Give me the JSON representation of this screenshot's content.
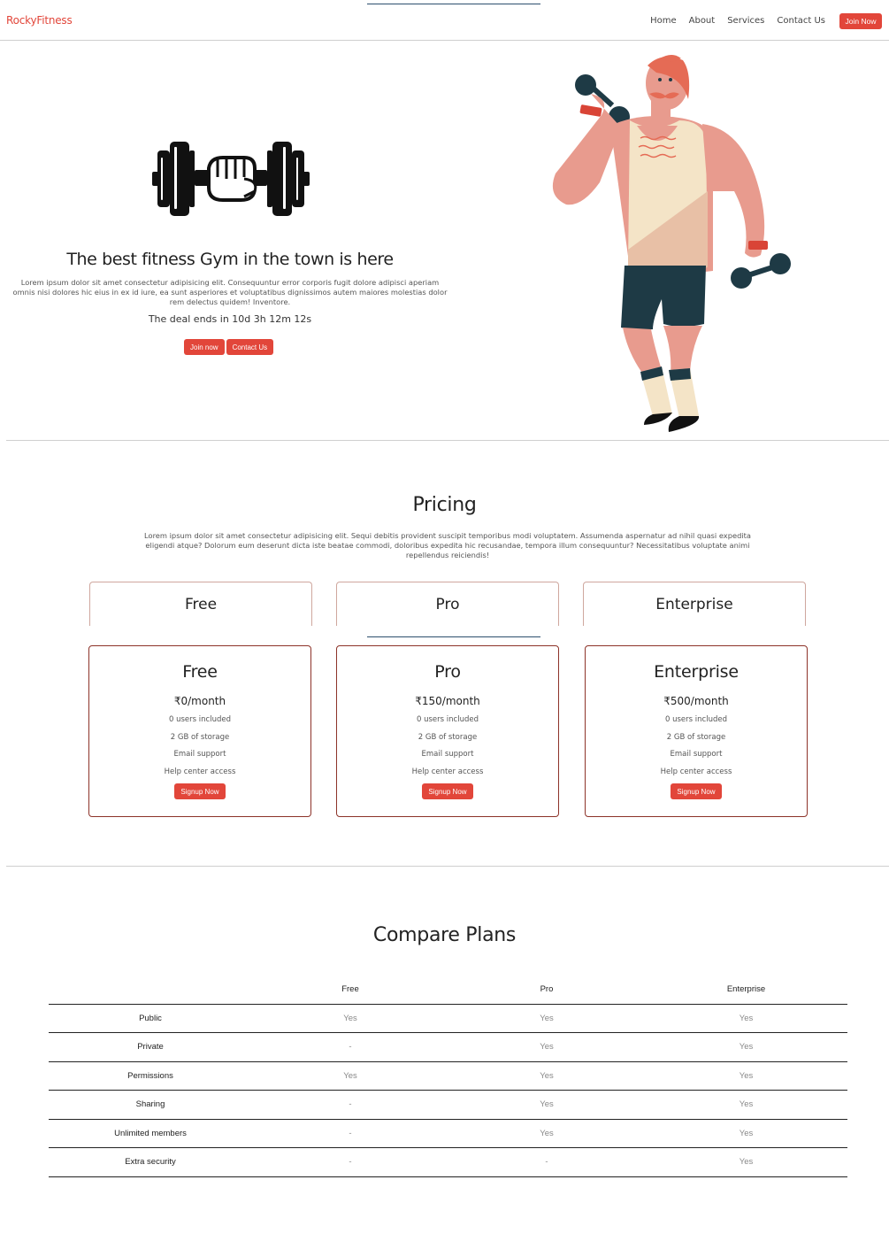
{
  "nav": {
    "brand": "RockyFitness",
    "links": [
      "Home",
      "About",
      "Services",
      "Contact Us"
    ],
    "cta": "Join Now"
  },
  "hero": {
    "title": "The best fitness Gym in the town is here",
    "description": "Lorem ipsum dolor sit amet consectetur adipisicing elit. Consequuntur error corporis fugit dolore adipisci aperiam omnis nisi dolores hic eius in ex id iure, ea sunt asperiores et voluptatibus dignissimos autem maiores molestias dolor rem delectus quidem! Inventore.",
    "deal": "The deal ends in 10d 3h 12m 12s",
    "buttons": [
      "Join now",
      "Contact Us"
    ]
  },
  "pricing": {
    "title": "Pricing",
    "description": "Lorem ipsum dolor sit amet consectetur adipisicing elit. Sequi debitis provident suscipit temporibus modi voluptatem. Assumenda aspernatur ad nihil quasi expedita eligendi atque? Dolorum eum deserunt dicta iste beatae commodi, doloribus expedita hic recusandae, tempora illum consequuntur? Necessitatibus voluptate animi repellendus reiciendis!",
    "tabs": [
      "Free",
      "Pro",
      "Enterprise"
    ],
    "cards": [
      {
        "name": "Free",
        "price": "₹0/month",
        "features": [
          "0 users included",
          "2 GB of storage",
          "Email support",
          "Help center access"
        ],
        "button": "Signup Now"
      },
      {
        "name": "Pro",
        "price": "₹150/month",
        "features": [
          "0 users included",
          "2 GB of storage",
          "Email support",
          "Help center access"
        ],
        "button": "Signup Now"
      },
      {
        "name": "Enterprise",
        "price": "₹500/month",
        "features": [
          "0 users included",
          "2 GB of storage",
          "Email support",
          "Help center access"
        ],
        "button": "Signup Now"
      }
    ]
  },
  "compare": {
    "title": "Compare Plans",
    "headers": [
      "",
      "Free",
      "Pro",
      "Enterprise"
    ],
    "rows": [
      [
        "Public",
        "Yes",
        "Yes",
        "Yes"
      ],
      [
        "Private",
        "-",
        "Yes",
        "Yes"
      ],
      [
        "Permissions",
        "Yes",
        "Yes",
        "Yes"
      ],
      [
        "Sharing",
        "-",
        "Yes",
        "Yes"
      ],
      [
        "Unlimited members",
        "-",
        "Yes",
        "Yes"
      ],
      [
        "Extra security",
        "-",
        "-",
        "Yes"
      ]
    ]
  },
  "colors": {
    "accent": "#e2463a",
    "card_border": "#8d3329",
    "divider": "#cfcfcf",
    "focus_line": "#2d4f6e"
  }
}
